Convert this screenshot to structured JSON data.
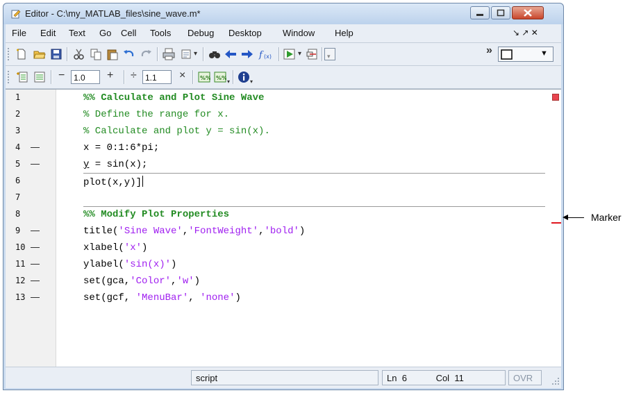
{
  "window": {
    "title": "Editor - C:\\my_MATLAB_files\\sine_wave.m*"
  },
  "menu": {
    "items": [
      "File",
      "Edit",
      "Text",
      "Go",
      "Cell",
      "Tools",
      "Debug",
      "Desktop",
      "Window",
      "Help"
    ],
    "right_controls": "↘ ↗ ✕"
  },
  "toolbar": {
    "icons": [
      "new-file-icon",
      "open-folder-icon",
      "save-icon",
      "cut-icon",
      "copy-icon",
      "paste-icon",
      "undo-icon",
      "redo-icon",
      "print-icon",
      "find-files-icon",
      "find-icon",
      "back-icon",
      "forward-icon",
      "function-icon",
      "run-icon",
      "breakpoint-icon",
      "stack-icon",
      "layout-icon"
    ],
    "overflow": "»"
  },
  "cell_toolbar": {
    "minus": "−",
    "value1": "1.0",
    "plus": "+",
    "divide": "÷",
    "value2": "1.1",
    "times": "×"
  },
  "code": {
    "lines": [
      {
        "num": "1",
        "dash": "",
        "text": "%% Calculate and Plot Sine Wave"
      },
      {
        "num": "2",
        "dash": "",
        "text": "% Define the range for x."
      },
      {
        "num": "3",
        "dash": "",
        "text": "% Calculate and plot y = sin(x)."
      },
      {
        "num": "4",
        "dash": "—",
        "text": "x = 0:1:6*pi;"
      },
      {
        "num": "5",
        "dash": "—",
        "text_pre": "y",
        "text_post": " = sin(x);"
      },
      {
        "num": "6",
        "dash": "",
        "text": "plot(x,y)]"
      },
      {
        "num": "7",
        "dash": "",
        "text": ""
      },
      {
        "num": "8",
        "dash": "",
        "text": "%% Modify Plot Properties"
      },
      {
        "num": "9",
        "dash": "—",
        "fn": "title(",
        "s1": "'Sine Wave'",
        "c1": ",",
        "s2": "'FontWeight'",
        "c2": ",",
        "s3": "'bold'",
        "end": ")"
      },
      {
        "num": "10",
        "dash": "—",
        "fn": "xlabel(",
        "s1": "'x'",
        "end": ")"
      },
      {
        "num": "11",
        "dash": "—",
        "fn": "ylabel(",
        "s1": "'sin(x)'",
        "end": ")"
      },
      {
        "num": "12",
        "dash": "—",
        "fn": "set(gca,",
        "s1": "'Color'",
        "c1": ",",
        "s2": "'w'",
        "end": ")"
      },
      {
        "num": "13",
        "dash": "—",
        "fn": "set(gcf, ",
        "s1": "'MenuBar'",
        "c1": ", ",
        "s2": "'none'",
        "end": ")"
      }
    ]
  },
  "status": {
    "mode": "script",
    "ln_label": "Ln",
    "ln": "6",
    "col_label": "Col",
    "col": "11",
    "ovr": "OVR"
  },
  "annotation": {
    "label": "Marker"
  },
  "colors": {
    "comment": "#228b22",
    "string": "#a020f0",
    "marker": "#e0161e"
  }
}
